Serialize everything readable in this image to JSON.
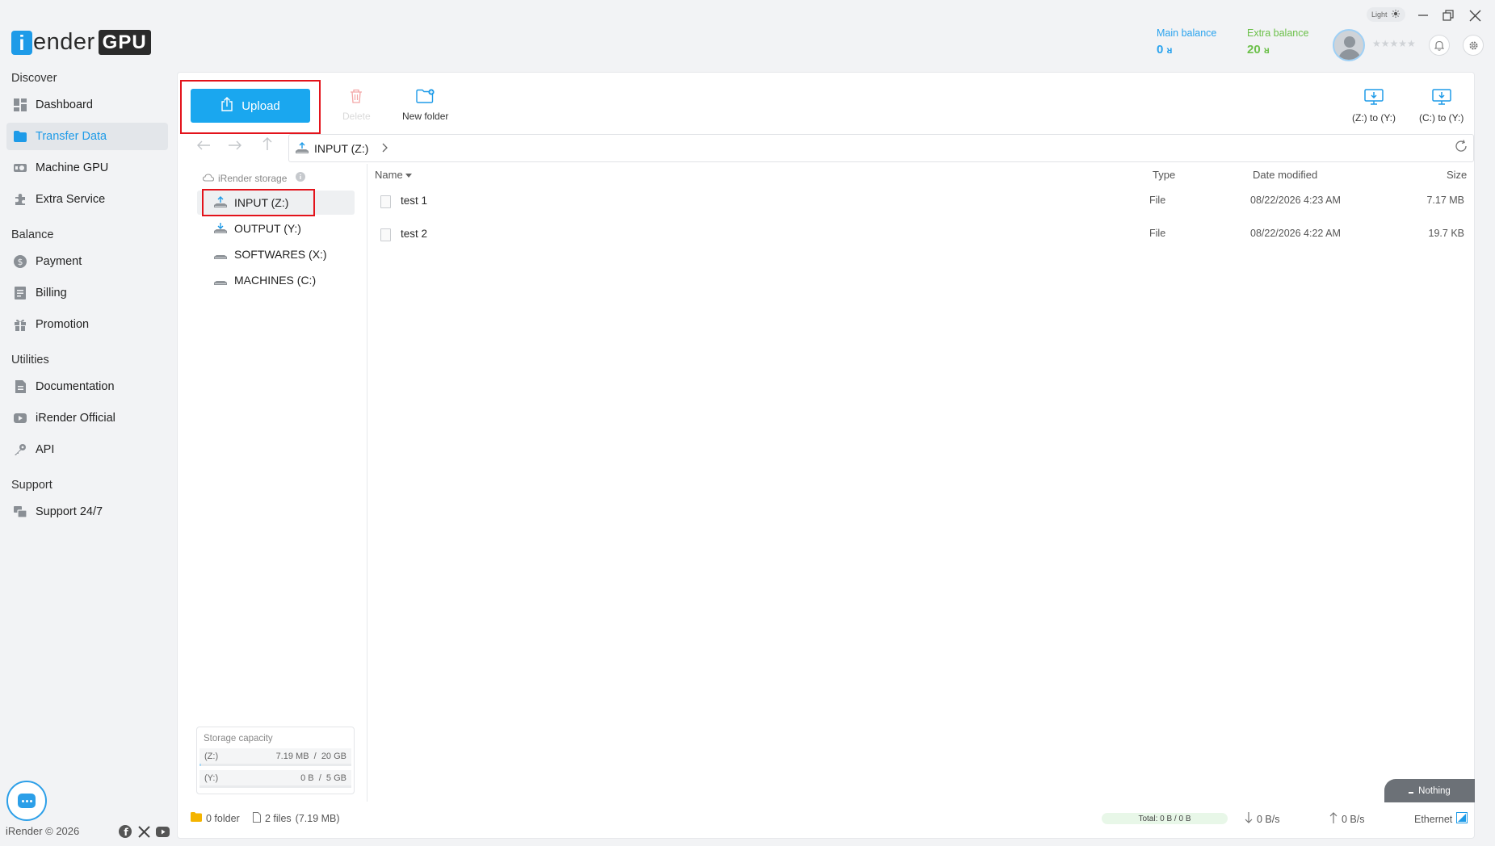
{
  "app": {
    "logo_i": "i",
    "logo_text": "Render",
    "logo_badge": "GPU",
    "brand_color": "#1e9be8"
  },
  "sidebar": {
    "sections": [
      {
        "title": "Discover",
        "items": [
          {
            "label": "Dashboard",
            "icon": "dashboard-icon"
          },
          {
            "label": "Transfer Data",
            "icon": "folder-icon",
            "active": true
          },
          {
            "label": "Machine GPU",
            "icon": "gpu-icon"
          },
          {
            "label": "Extra Service",
            "icon": "puzzle-icon"
          }
        ]
      },
      {
        "title": "Balance",
        "items": [
          {
            "label": "Payment",
            "icon": "dollar-icon"
          },
          {
            "label": "Billing",
            "icon": "receipt-icon"
          },
          {
            "label": "Promotion",
            "icon": "gift-icon"
          }
        ]
      },
      {
        "title": "Utilities",
        "items": [
          {
            "label": "Documentation",
            "icon": "document-icon"
          },
          {
            "label": "iRender Official",
            "icon": "video-icon"
          },
          {
            "label": "API",
            "icon": "key-icon"
          }
        ]
      },
      {
        "title": "Support",
        "items": [
          {
            "label": "Support 24/7",
            "icon": "support-icon"
          }
        ]
      }
    ],
    "copyright": "iRender © 2026"
  },
  "header": {
    "theme_label": "Light",
    "main_balance_label": "Main balance",
    "main_balance_value": "0",
    "extra_balance_label": "Extra balance",
    "extra_balance_value": "20",
    "currency_symbol": "ᴚ",
    "main_balance_color": "#2aa3ee",
    "extra_balance_color": "#6cc04a",
    "stars": "★★★★★"
  },
  "toolbar": {
    "upload_label": "Upload",
    "delete_label": "Delete",
    "new_folder_label": "New folder",
    "z_to_y_label": "(Z:) to (Y:)",
    "c_to_y_label": "(C:) to (Y:)"
  },
  "address": {
    "path": "INPUT (Z:)"
  },
  "tree": {
    "header": "iRender storage",
    "items": [
      {
        "label": "INPUT (Z:)",
        "selected": true
      },
      {
        "label": "OUTPUT (Y:)"
      },
      {
        "label": "SOFTWARES (X:)"
      },
      {
        "label": "MACHINES (C:)"
      }
    ]
  },
  "capacity": {
    "title": "Storage capacity",
    "rows": [
      {
        "drive": "(Z:)",
        "used": "7.19 MB",
        "total": "20 GB",
        "fill_fraction": 0.0004
      },
      {
        "drive": "(Y:)",
        "used": "0 B",
        "total": "5 GB",
        "fill_fraction": 0
      }
    ]
  },
  "table": {
    "columns": {
      "name": "Name",
      "type": "Type",
      "date": "Date modified",
      "size": "Size"
    },
    "rows": [
      {
        "name": "test 1",
        "type": "File",
        "date": "08/22/2026 4:23 AM",
        "size": "7.17 MB"
      },
      {
        "name": "test 2",
        "type": "File",
        "date": "08/22/2026 4:22 AM",
        "size": "19.7 KB"
      }
    ]
  },
  "statusbar": {
    "folders": "0 folder",
    "files": "2 files",
    "files_size": "(7.19 MB)",
    "total": "Total: 0 B / 0 B",
    "download_speed": "0 B/s",
    "upload_speed": "0 B/s",
    "network": "Ethernet",
    "nothing_label": "Nothing"
  }
}
